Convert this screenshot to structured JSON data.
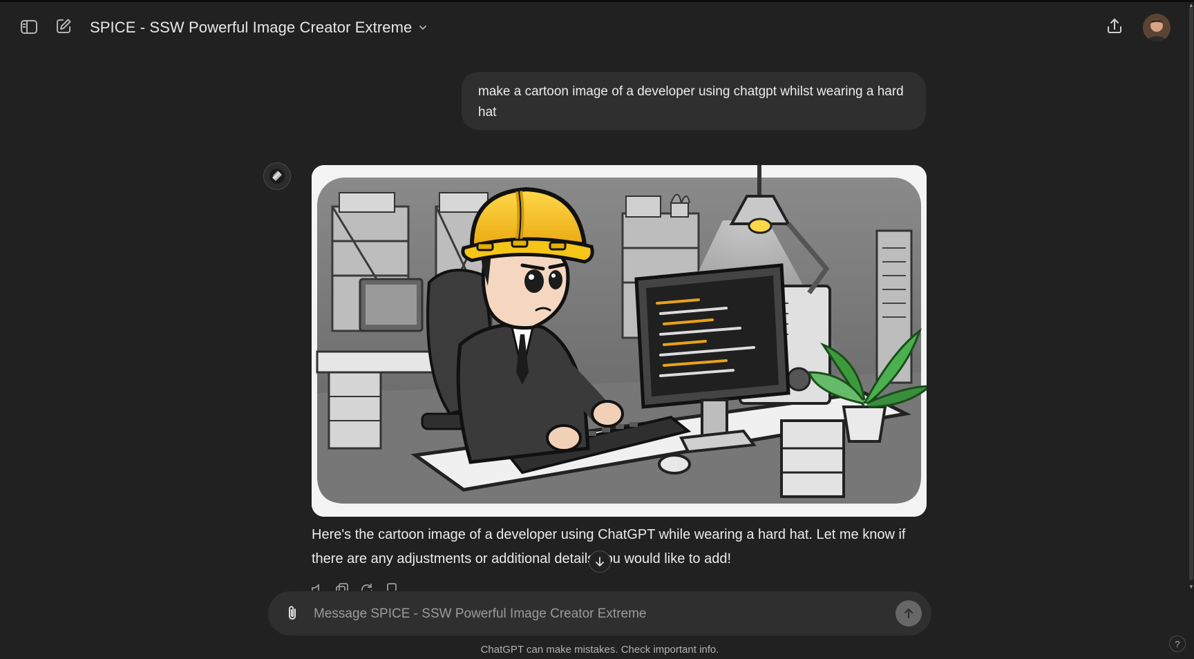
{
  "header": {
    "title": "SPICE - SSW Powerful Image Creator Extreme",
    "icons": [
      "sidebar-toggle-icon",
      "new-chat-icon",
      "chevron-down-icon",
      "share-icon"
    ]
  },
  "conversation": {
    "user_message": "make a cartoon image of a developer using chatgpt whilst wearing a hard hat",
    "assistant_message": "Here's the cartoon image of a developer using ChatGPT while wearing a hard hat. Let me know if there are any adjustments or additional details you would like to add!",
    "image_icon": "generated-image-developer-hard-hat"
  },
  "composer": {
    "placeholder": "Message SPICE - SSW Powerful Image Creator Extreme"
  },
  "footer": {
    "disclaimer": "ChatGPT can make mistakes. Check important info.",
    "help_label": "?"
  },
  "colors": {
    "background": "#212121",
    "bubble": "#2f2f2f",
    "hard_hat": "#f5c518"
  }
}
